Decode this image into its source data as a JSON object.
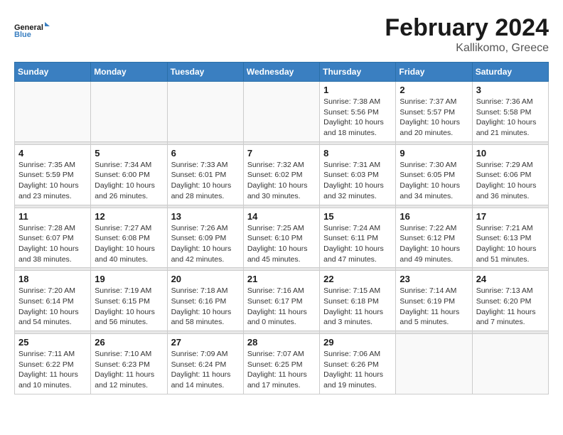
{
  "header": {
    "logo_general": "General",
    "logo_blue": "Blue",
    "title": "February 2024",
    "subtitle": "Kallikomo, Greece"
  },
  "calendar": {
    "days_of_week": [
      "Sunday",
      "Monday",
      "Tuesday",
      "Wednesday",
      "Thursday",
      "Friday",
      "Saturday"
    ],
    "weeks": [
      {
        "days": [
          {
            "number": "",
            "info": ""
          },
          {
            "number": "",
            "info": ""
          },
          {
            "number": "",
            "info": ""
          },
          {
            "number": "",
            "info": ""
          },
          {
            "number": "1",
            "info": "Sunrise: 7:38 AM\nSunset: 5:56 PM\nDaylight: 10 hours\nand 18 minutes."
          },
          {
            "number": "2",
            "info": "Sunrise: 7:37 AM\nSunset: 5:57 PM\nDaylight: 10 hours\nand 20 minutes."
          },
          {
            "number": "3",
            "info": "Sunrise: 7:36 AM\nSunset: 5:58 PM\nDaylight: 10 hours\nand 21 minutes."
          }
        ]
      },
      {
        "days": [
          {
            "number": "4",
            "info": "Sunrise: 7:35 AM\nSunset: 5:59 PM\nDaylight: 10 hours\nand 23 minutes."
          },
          {
            "number": "5",
            "info": "Sunrise: 7:34 AM\nSunset: 6:00 PM\nDaylight: 10 hours\nand 26 minutes."
          },
          {
            "number": "6",
            "info": "Sunrise: 7:33 AM\nSunset: 6:01 PM\nDaylight: 10 hours\nand 28 minutes."
          },
          {
            "number": "7",
            "info": "Sunrise: 7:32 AM\nSunset: 6:02 PM\nDaylight: 10 hours\nand 30 minutes."
          },
          {
            "number": "8",
            "info": "Sunrise: 7:31 AM\nSunset: 6:03 PM\nDaylight: 10 hours\nand 32 minutes."
          },
          {
            "number": "9",
            "info": "Sunrise: 7:30 AM\nSunset: 6:05 PM\nDaylight: 10 hours\nand 34 minutes."
          },
          {
            "number": "10",
            "info": "Sunrise: 7:29 AM\nSunset: 6:06 PM\nDaylight: 10 hours\nand 36 minutes."
          }
        ]
      },
      {
        "days": [
          {
            "number": "11",
            "info": "Sunrise: 7:28 AM\nSunset: 6:07 PM\nDaylight: 10 hours\nand 38 minutes."
          },
          {
            "number": "12",
            "info": "Sunrise: 7:27 AM\nSunset: 6:08 PM\nDaylight: 10 hours\nand 40 minutes."
          },
          {
            "number": "13",
            "info": "Sunrise: 7:26 AM\nSunset: 6:09 PM\nDaylight: 10 hours\nand 42 minutes."
          },
          {
            "number": "14",
            "info": "Sunrise: 7:25 AM\nSunset: 6:10 PM\nDaylight: 10 hours\nand 45 minutes."
          },
          {
            "number": "15",
            "info": "Sunrise: 7:24 AM\nSunset: 6:11 PM\nDaylight: 10 hours\nand 47 minutes."
          },
          {
            "number": "16",
            "info": "Sunrise: 7:22 AM\nSunset: 6:12 PM\nDaylight: 10 hours\nand 49 minutes."
          },
          {
            "number": "17",
            "info": "Sunrise: 7:21 AM\nSunset: 6:13 PM\nDaylight: 10 hours\nand 51 minutes."
          }
        ]
      },
      {
        "days": [
          {
            "number": "18",
            "info": "Sunrise: 7:20 AM\nSunset: 6:14 PM\nDaylight: 10 hours\nand 54 minutes."
          },
          {
            "number": "19",
            "info": "Sunrise: 7:19 AM\nSunset: 6:15 PM\nDaylight: 10 hours\nand 56 minutes."
          },
          {
            "number": "20",
            "info": "Sunrise: 7:18 AM\nSunset: 6:16 PM\nDaylight: 10 hours\nand 58 minutes."
          },
          {
            "number": "21",
            "info": "Sunrise: 7:16 AM\nSunset: 6:17 PM\nDaylight: 11 hours\nand 0 minutes."
          },
          {
            "number": "22",
            "info": "Sunrise: 7:15 AM\nSunset: 6:18 PM\nDaylight: 11 hours\nand 3 minutes."
          },
          {
            "number": "23",
            "info": "Sunrise: 7:14 AM\nSunset: 6:19 PM\nDaylight: 11 hours\nand 5 minutes."
          },
          {
            "number": "24",
            "info": "Sunrise: 7:13 AM\nSunset: 6:20 PM\nDaylight: 11 hours\nand 7 minutes."
          }
        ]
      },
      {
        "days": [
          {
            "number": "25",
            "info": "Sunrise: 7:11 AM\nSunset: 6:22 PM\nDaylight: 11 hours\nand 10 minutes."
          },
          {
            "number": "26",
            "info": "Sunrise: 7:10 AM\nSunset: 6:23 PM\nDaylight: 11 hours\nand 12 minutes."
          },
          {
            "number": "27",
            "info": "Sunrise: 7:09 AM\nSunset: 6:24 PM\nDaylight: 11 hours\nand 14 minutes."
          },
          {
            "number": "28",
            "info": "Sunrise: 7:07 AM\nSunset: 6:25 PM\nDaylight: 11 hours\nand 17 minutes."
          },
          {
            "number": "29",
            "info": "Sunrise: 7:06 AM\nSunset: 6:26 PM\nDaylight: 11 hours\nand 19 minutes."
          },
          {
            "number": "",
            "info": ""
          },
          {
            "number": "",
            "info": ""
          }
        ]
      }
    ]
  }
}
